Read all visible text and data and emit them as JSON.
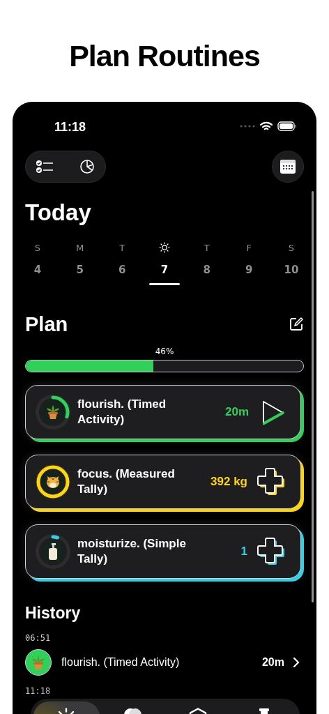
{
  "headline": "Plan Routines",
  "status_bar": {
    "time": "11:18"
  },
  "toolbar": {
    "view_toggle": [
      {
        "kind": "list"
      },
      {
        "kind": "chart"
      }
    ]
  },
  "today": {
    "title": "Today",
    "days": [
      {
        "label": "S",
        "number": "4",
        "selected": false
      },
      {
        "label": "M",
        "number": "5",
        "selected": false
      },
      {
        "label": "T",
        "number": "6",
        "selected": false
      },
      {
        "number": "7",
        "selected": true
      },
      {
        "label": "T",
        "number": "8",
        "selected": false
      },
      {
        "label": "F",
        "number": "9",
        "selected": false
      },
      {
        "label": "S",
        "number": "10",
        "selected": false
      }
    ]
  },
  "plan": {
    "title": "Plan",
    "progress_label": "46%",
    "level": 0.46,
    "items": [
      {
        "kind": "timed",
        "name": "flourish. (Timed Activity)",
        "value": "20m",
        "color": "#30d158",
        "level": 0.3
      },
      {
        "kind": "measured",
        "name": "focus. (Measured Tally)",
        "value": "392 kg",
        "color": "#ffd60a",
        "level": 1
      },
      {
        "kind": "simple",
        "name": "moisturize. (Simple Tally)",
        "value": "1",
        "color": "#32d2e6",
        "level": 0.05
      }
    ]
  },
  "history": {
    "title": "History",
    "entries": [
      {
        "time": "06:51",
        "name": "flourish. (Timed Activity)",
        "value": "20m"
      },
      {
        "time": "11:18"
      }
    ]
  },
  "tab_bar": [
    {
      "kind": "sun",
      "selected": true
    },
    {
      "kind": "circles",
      "selected": false
    },
    {
      "kind": "hexagon",
      "selected": false
    },
    {
      "kind": "timer",
      "selected": false
    }
  ]
}
